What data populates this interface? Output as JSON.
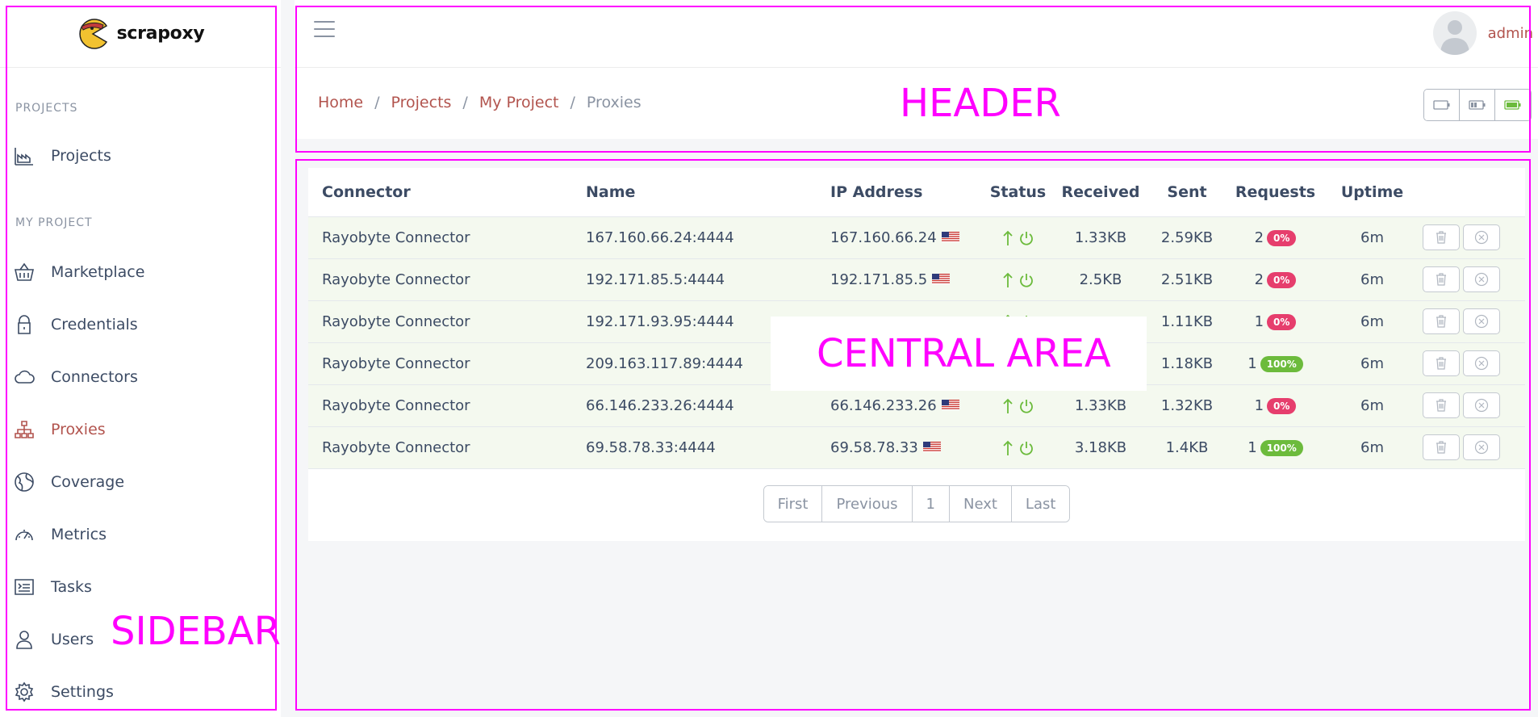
{
  "brand": {
    "name": "scrapoxy"
  },
  "sidebar": {
    "sections": [
      {
        "title": "PROJECTS"
      },
      {
        "title": "MY PROJECT"
      }
    ],
    "items": [
      {
        "label": "Projects",
        "icon": "factory-icon"
      },
      {
        "label": "Marketplace",
        "icon": "basket-icon"
      },
      {
        "label": "Credentials",
        "icon": "lock-icon"
      },
      {
        "label": "Connectors",
        "icon": "cloud-icon"
      },
      {
        "label": "Proxies",
        "icon": "sitemap-icon",
        "active": true
      },
      {
        "label": "Coverage",
        "icon": "globe-icon"
      },
      {
        "label": "Metrics",
        "icon": "speedometer-icon"
      },
      {
        "label": "Tasks",
        "icon": "terminal-icon"
      },
      {
        "label": "Users",
        "icon": "user-icon"
      },
      {
        "label": "Settings",
        "icon": "gear-icon"
      }
    ]
  },
  "header": {
    "username": "admin",
    "breadcrumb": [
      "Home",
      "Projects",
      "My Project",
      "Proxies"
    ]
  },
  "table": {
    "columns": [
      "Connector",
      "Name",
      "IP Address",
      "Status",
      "Received",
      "Sent",
      "Requests",
      "Uptime"
    ],
    "rows": [
      {
        "connector": "Rayobyte Connector",
        "name": "167.160.66.24:4444",
        "ip": "167.160.66.24",
        "received": "1.33KB",
        "sent": "2.59KB",
        "requests": "2",
        "rate": "0%",
        "uptime": "6m"
      },
      {
        "connector": "Rayobyte Connector",
        "name": "192.171.85.5:4444",
        "ip": "192.171.85.5",
        "received": "2.5KB",
        "sent": "2.51KB",
        "requests": "2",
        "rate": "0%",
        "uptime": "6m"
      },
      {
        "connector": "Rayobyte Connector",
        "name": "192.171.93.95:4444",
        "ip": "",
        "received": "",
        "sent": "1.11KB",
        "requests": "1",
        "rate": "0%",
        "uptime": "6m"
      },
      {
        "connector": "Rayobyte Connector",
        "name": "209.163.117.89:4444",
        "ip": "",
        "received": "",
        "sent": "1.18KB",
        "requests": "1",
        "rate": "100%",
        "uptime": "6m"
      },
      {
        "connector": "Rayobyte Connector",
        "name": "66.146.233.26:4444",
        "ip": "66.146.233.26",
        "received": "1.33KB",
        "sent": "1.32KB",
        "requests": "1",
        "rate": "0%",
        "uptime": "6m"
      },
      {
        "connector": "Rayobyte Connector",
        "name": "69.58.78.33:4444",
        "ip": "69.58.78.33",
        "received": "3.18KB",
        "sent": "1.4KB",
        "requests": "1",
        "rate": "100%",
        "uptime": "6m"
      }
    ]
  },
  "pagination": [
    "First",
    "Previous",
    "1",
    "Next",
    "Last"
  ],
  "annotations": {
    "header": "HEADER",
    "central": "CENTRAL AREA",
    "sidebar": "SIDEBAR"
  },
  "colors": {
    "accent": "#b2544e",
    "success": "#6cbb3c",
    "danger": "#e63e6d",
    "row_bg": "#f4f9ef",
    "annotation": "#ff00ff"
  }
}
